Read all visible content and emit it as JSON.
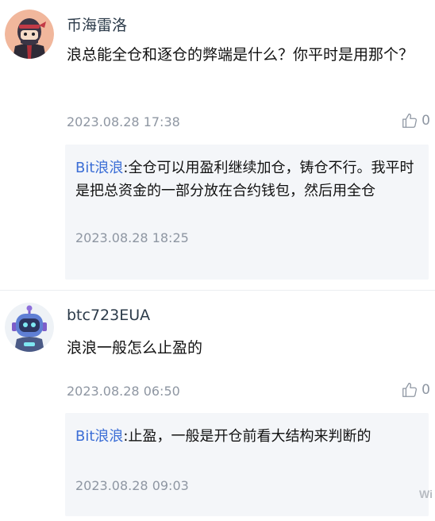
{
  "comments": [
    {
      "username": "币海雷洛",
      "content": "浪总能全仓和逐仓的弊端是什么？你平时是用那个？",
      "time": "2023.08.28 17:38",
      "likes": "0",
      "reply": {
        "author": "Bit浪浪",
        "text": ":全仓可以用盈利继续加仓，铸仓不行。我平时是把总资金的一部分放在合约钱包，然后用全仓",
        "time": "2023.08.28 18:25"
      }
    },
    {
      "username": "btc723EUA",
      "content": "浪浪一般怎么止盈的",
      "time": "2023.08.28 06:50",
      "likes": "0",
      "reply": {
        "author": "Bit浪浪",
        "text": ":止盈，一般是开仓前看大结构来判断的",
        "time": "2023.08.28 09:03"
      }
    }
  ],
  "watermark": "Wi",
  "icons": {
    "like": "thumbs-up-icon"
  },
  "colors": {
    "link": "#3d6fd6",
    "meta": "#8e96a2",
    "reply_bg": "#f4f6f9"
  }
}
